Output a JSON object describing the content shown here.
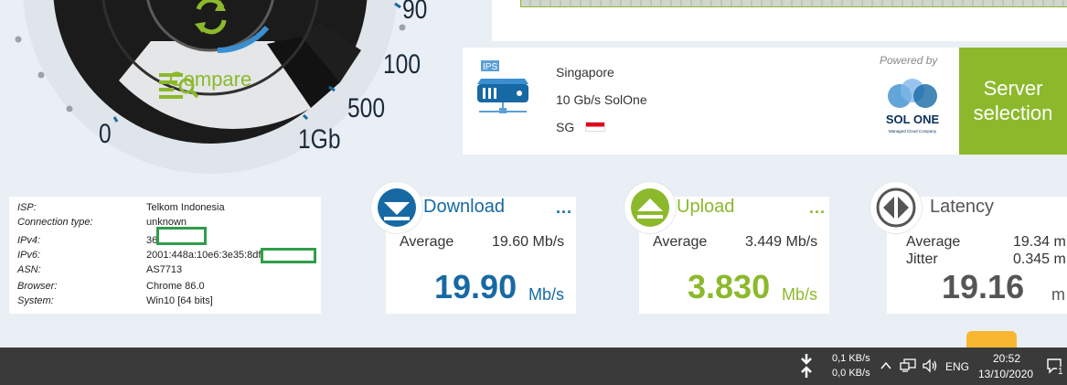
{
  "gauge": {
    "scale_labels": [
      "0",
      "1Gb",
      "500",
      "100",
      "90"
    ],
    "compare_label": "Compare"
  },
  "server": {
    "icon_label": "IPS",
    "city": "Singapore",
    "provider": "10 Gb/s SolOne",
    "country_code": "SG",
    "powered_by": "Powered by",
    "sponsor_name": "SOL ONE",
    "sponsor_tagline": "Managed Cloud Company",
    "selection_button": "Server selection"
  },
  "info": {
    "rows": [
      {
        "key": "ISP:",
        "value": "Telkom Indonesia"
      },
      {
        "key": "Connection type:",
        "value": "unknown"
      },
      {
        "key": "IPv4:",
        "value": "36."
      },
      {
        "key": "IPv6:",
        "value": "2001:448a:10e6:3e35:8df"
      },
      {
        "key": "ASN:",
        "value": "AS7713"
      },
      {
        "key": "Browser:",
        "value": "Chrome 86.0"
      },
      {
        "key": "System:",
        "value": "Win10 [64 bits]"
      }
    ]
  },
  "download": {
    "title": "Download",
    "more": "...",
    "avg_label": "Average",
    "avg_value": "19.60 Mb/s",
    "current": "19.90",
    "unit": "Mb/s"
  },
  "upload": {
    "title": "Upload",
    "more": "...",
    "avg_label": "Average",
    "avg_value": "3.449 Mb/s",
    "current": "3.830",
    "unit": "Mb/s"
  },
  "latency": {
    "title": "Latency",
    "avg_label": "Average",
    "avg_value": "19.34 m",
    "jitter_label": "Jitter",
    "jitter_value": "0.345 m",
    "current": "19.16",
    "unit": "m"
  },
  "taskbar": {
    "net_down": "0,1 KB/s",
    "net_up": "0,0 KB/s",
    "language": "ENG",
    "time": "20:52",
    "date": "13/10/2020",
    "notification_count": "1"
  },
  "colors": {
    "download": "#1769a4",
    "upload": "#8cb92c",
    "latency_text": "#555555",
    "dark_gauge": "#1b1b1b",
    "taskbar": "#3a3a3a"
  }
}
